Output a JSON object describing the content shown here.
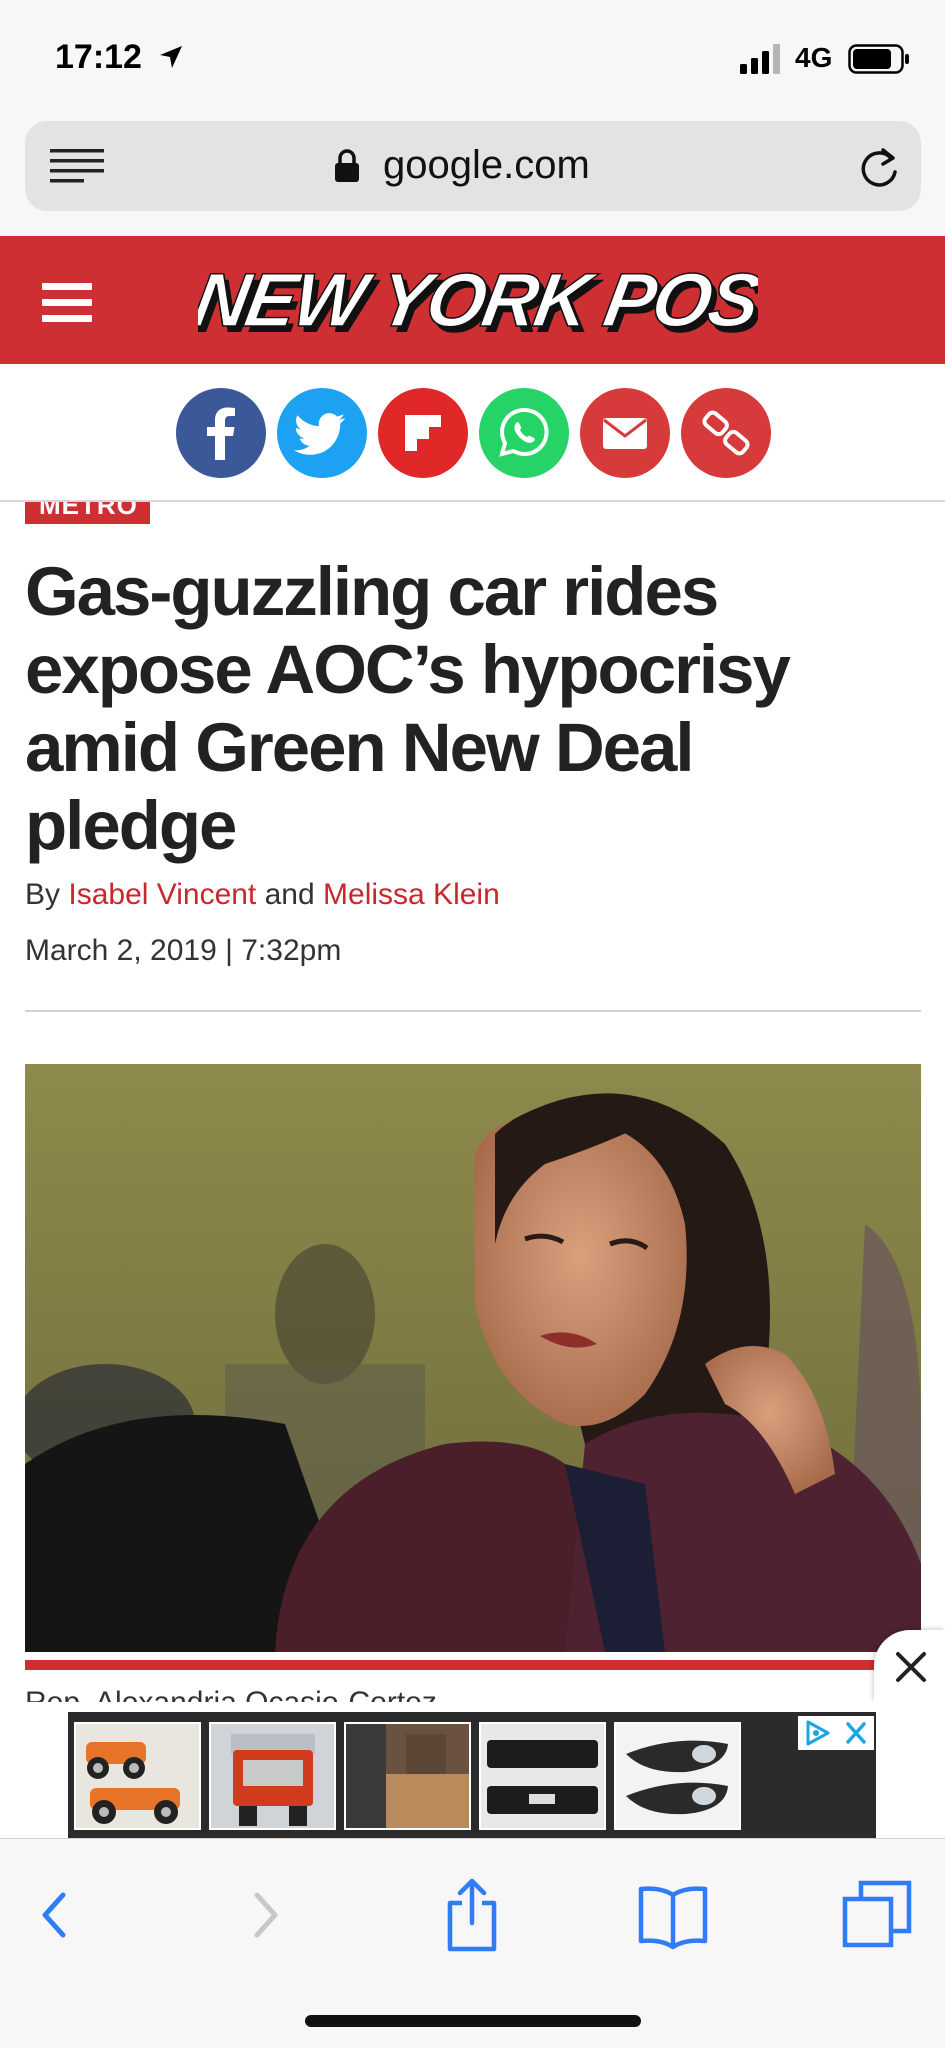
{
  "status_bar": {
    "time": "17:12",
    "network": "4G"
  },
  "browser": {
    "url": "google.com"
  },
  "site": {
    "logo_text": "NEW YORK POST",
    "brand_color": "#cd2f32"
  },
  "share": {
    "buttons": [
      {
        "name": "facebook",
        "icon": "facebook-icon",
        "color": "#3b5998"
      },
      {
        "name": "twitter",
        "icon": "twitter-icon",
        "color": "#1da1f2"
      },
      {
        "name": "flipboard",
        "icon": "flipboard-icon",
        "color": "#e12828"
      },
      {
        "name": "whatsapp",
        "icon": "whatsapp-icon",
        "color": "#25d366"
      },
      {
        "name": "email",
        "icon": "mail-icon",
        "color": "#d63a3a"
      },
      {
        "name": "copy-link",
        "icon": "link-icon",
        "color": "#d63a3a"
      }
    ]
  },
  "article": {
    "section": "METRO",
    "headline": "Gas-guzzling car rides expose AOC’s hypocrisy amid Green New Deal pledge",
    "byline_prefix": "By",
    "author_1": "Isabel Vincent",
    "byline_join": "and",
    "author_2": "Melissa Klein",
    "date": "March 2, 2019 | 7:32pm",
    "caption": "Rep. Alexandria Ocasio-Cortez"
  },
  "toolbar": {
    "buttons": [
      "back",
      "forward",
      "share",
      "bookmarks",
      "tabs"
    ],
    "accent_color": "#2f7cf6"
  }
}
